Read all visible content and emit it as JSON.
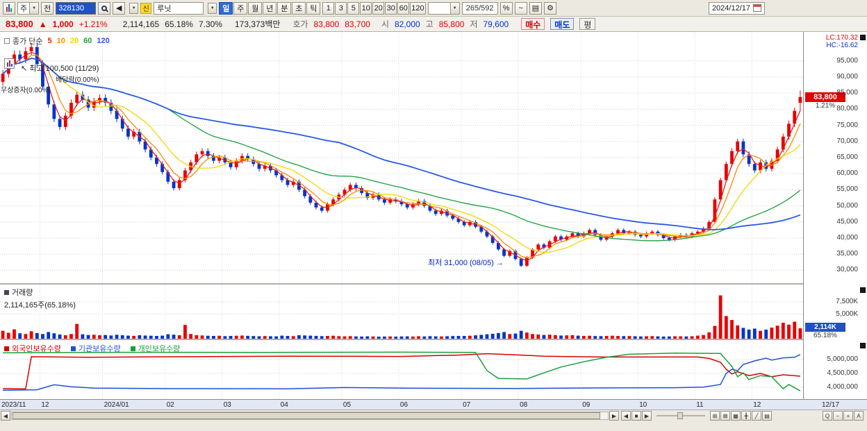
{
  "toolbar": {
    "market_combo": "주",
    "jeon_button": "전",
    "code_input": "328130",
    "prev_button": "◀",
    "new_badge": "신",
    "stock_name": "루닛",
    "period_buttons": [
      {
        "label": "일",
        "active": true
      },
      {
        "label": "주",
        "active": false
      },
      {
        "label": "월",
        "active": false
      },
      {
        "label": "년",
        "active": false
      },
      {
        "label": "분",
        "active": false
      },
      {
        "label": "초",
        "active": false
      },
      {
        "label": "틱",
        "active": false
      }
    ],
    "interval_buttons": [
      "1",
      "3",
      "5",
      "10",
      "20",
      "30",
      "60",
      "120"
    ],
    "bar_position": "265/592",
    "icons": {
      "percent": "%",
      "wave": "~",
      "save": "▤",
      "gear": "⚙"
    },
    "date": "2024/12/17"
  },
  "quote": {
    "price": "83,800",
    "arrow": "▲",
    "change": "1,000",
    "change_pct": "+1.21%",
    "volume": "2,114,165",
    "volume_ratio": "65.18%",
    "turnover": "7.30%",
    "value": "173,373백만",
    "hoga_label": "호가",
    "ask": "83,800",
    "bid": "83,700",
    "open_label": "시",
    "open": "82,000",
    "high_label": "고",
    "high": "85,800",
    "low_label": "저",
    "low": "79,600",
    "buy": "매수",
    "sell": "매도",
    "avg": "평"
  },
  "main_chart": {
    "legend_title": "종가 단순",
    "annotations": {
      "high": "최고 100,500 (11/29)",
      "high_arrow": "↖",
      "ex_dividend": "배당락(0.00%)",
      "bonus": "무상증자(0.00%)",
      "low": "최저 31,000 (08/05)",
      "low_arrow": "→"
    },
    "right_axis": {
      "lc": "LC:170.32",
      "hc": "HC:-16.62",
      "ticks": [
        95000,
        90000,
        85000,
        80000,
        75000,
        70000,
        65000,
        60000,
        55000,
        50000,
        45000,
        40000,
        35000,
        30000
      ],
      "price_box": "83,800",
      "price_box_pct": "1.21%",
      "price_box_value": 83800
    }
  },
  "volume_pane": {
    "title": "거래량",
    "subtitle": "2,114,165주(65.18%)",
    "ticks": [
      {
        "label": "7,500K",
        "v": 7500
      },
      {
        "label": "5,000K",
        "v": 5000
      }
    ],
    "box": "2,114K",
    "box_pct": "65.18%",
    "box_value": 2114
  },
  "holdings_pane": {
    "legend": [
      {
        "label": "외국인보유수량",
        "color": "#d40000"
      },
      {
        "label": "기관보유수량",
        "color": "#2050d8"
      },
      {
        "label": "개인보유수량",
        "color": "#18a038"
      }
    ],
    "ticks": [
      {
        "label": "5,000,000",
        "v": 5000000
      },
      {
        "label": "4,500,000",
        "v": 4500000
      },
      {
        "label": "4,000,000",
        "v": 4000000
      }
    ]
  },
  "x_axis": {
    "labels": [
      {
        "text": "2023/11",
        "i": 0
      },
      {
        "text": "12",
        "i": 7
      },
      {
        "text": "2024/01",
        "i": 18
      },
      {
        "text": "02",
        "i": 29
      },
      {
        "text": "03",
        "i": 39
      },
      {
        "text": "04",
        "i": 49
      },
      {
        "text": "05",
        "i": 60
      },
      {
        "text": "06",
        "i": 70
      },
      {
        "text": "07",
        "i": 81
      },
      {
        "text": "08",
        "i": 91
      },
      {
        "text": "09",
        "i": 102
      },
      {
        "text": "10",
        "i": 112
      },
      {
        "text": "11",
        "i": 122
      },
      {
        "text": "12",
        "i": 132
      }
    ],
    "end_label": "12/17"
  },
  "bottom_bar": {
    "scroll_left": "◀",
    "scroll_right": "▶",
    "playback": [
      "◀",
      "■",
      "▶"
    ],
    "tools": [
      "⊞",
      "⊠",
      "▦",
      "╋",
      "╱",
      "▤"
    ],
    "tool_names": [
      "zoom-area-icon",
      "select-box-icon",
      "grid-icon",
      "crosshair-icon",
      "trendline-icon",
      "panel-layout-icon"
    ],
    "zoom": [
      "Q",
      "−",
      "+",
      "A"
    ],
    "zoom_names": [
      "magnifier-icon",
      "zoom-out-button",
      "zoom-in-button",
      "auto-scale-button"
    ]
  },
  "chart_data": {
    "type": "candlestick",
    "price_range": [
      26000,
      104000
    ],
    "volume_range_k": [
      0,
      11000
    ],
    "holdings_range": [
      3575000,
      5700000
    ],
    "up_color": "#e80000",
    "down_color": "#0033cc",
    "first_open": 88500,
    "last_candle": {
      "open": 82000,
      "high": 85800,
      "low": 79600,
      "close": 83800
    },
    "ma": [
      {
        "label": "5",
        "color": "#e02020",
        "window": 3
      },
      {
        "label": "10",
        "color": "#ff8a00",
        "window": 5
      },
      {
        "label": "20",
        "color": "#f0d800",
        "window": 10
      },
      {
        "label": "60",
        "color": "#18a038",
        "window": 30
      },
      {
        "label": "120",
        "color": "#2858e8",
        "window": 60
      }
    ],
    "closes": [
      91000,
      94000,
      97000,
      95500,
      98000,
      99300,
      94000,
      87000,
      81500,
      77000,
      74500,
      78000,
      82000,
      84500,
      83000,
      80500,
      82500,
      83500,
      82000,
      79500,
      77000,
      74000,
      71500,
      73000,
      70000,
      67500,
      65000,
      63000,
      60500,
      57500,
      55500,
      58000,
      61000,
      63500,
      66000,
      67000,
      65500,
      64000,
      65000,
      63500,
      62000,
      64000,
      65500,
      64500,
      63000,
      61500,
      62500,
      61000,
      59500,
      58000,
      56500,
      57500,
      55000,
      53000,
      51000,
      49500,
      48500,
      50500,
      52000,
      53500,
      55000,
      56500,
      55500,
      54000,
      52500,
      53500,
      52000,
      51000,
      52000,
      51500,
      50500,
      49500,
      50500,
      51500,
      50000,
      48500,
      47500,
      48500,
      47000,
      46000,
      45000,
      44000,
      45000,
      43500,
      42000,
      40500,
      38500,
      36500,
      34500,
      36000,
      33500,
      31400,
      34000,
      36500,
      38000,
      37000,
      39000,
      40500,
      39500,
      40500,
      41500,
      40500,
      41500,
      42500,
      41000,
      39500,
      40500,
      41500,
      42500,
      41500,
      42000,
      41000,
      40500,
      41500,
      42000,
      41000,
      40000,
      39500,
      40500,
      41000,
      40500,
      41500,
      42000,
      43000,
      45000,
      52000,
      58000,
      63000,
      67000,
      70000,
      66000,
      63000,
      61000,
      63500,
      61500,
      64000,
      67500,
      71500,
      75500,
      79500,
      83800
    ],
    "volumes_k": [
      1600,
      1200,
      1900,
      1100,
      950,
      1500,
      1150,
      950,
      1350,
      1100,
      850,
      700,
      950,
      3000,
      900,
      750,
      800,
      700,
      750,
      650,
      800,
      700,
      620,
      580,
      700,
      640,
      600,
      560,
      620,
      900,
      820,
      700,
      2800,
      950,
      720,
      660,
      600,
      560,
      600,
      520,
      560,
      600,
      640,
      580,
      540,
      500,
      540,
      500,
      480,
      620,
      560,
      520,
      700,
      660,
      620,
      580,
      520,
      560,
      600,
      520,
      480,
      520,
      460,
      440,
      480,
      460,
      420,
      440,
      460,
      430,
      460,
      480,
      440,
      500,
      460,
      520,
      480,
      460,
      500,
      540,
      560,
      560,
      600,
      680,
      780,
      900,
      1000,
      1150,
      1350,
      950,
      1050,
      1600,
      1250,
      950,
      850,
      750,
      820,
      720,
      640,
      680,
      720,
      620,
      560,
      600,
      540,
      520,
      560,
      600,
      560,
      520,
      540,
      500,
      460,
      500,
      520,
      480,
      440,
      460,
      500,
      480,
      460,
      500,
      620,
      750,
      1300,
      2600,
      8800,
      4600,
      3800,
      2700,
      2200,
      1850,
      2050,
      1600,
      1850,
      2250,
      2650,
      3250,
      2850,
      3450,
      2114
    ],
    "holdings": {
      "foreign": [
        [
          0,
          3950000
        ],
        [
          4,
          3940000
        ],
        [
          5,
          5100000
        ],
        [
          15,
          5080000
        ],
        [
          30,
          5100000
        ],
        [
          50,
          5120000
        ],
        [
          70,
          5110000
        ],
        [
          80,
          5160000
        ],
        [
          85,
          5210000
        ],
        [
          90,
          5170000
        ],
        [
          95,
          5120000
        ],
        [
          105,
          5090000
        ],
        [
          115,
          5090000
        ],
        [
          122,
          5090000
        ],
        [
          124,
          5040000
        ],
        [
          126,
          4900000
        ],
        [
          127,
          4650000
        ],
        [
          128,
          4480000
        ],
        [
          129,
          4560000
        ],
        [
          131,
          4420000
        ],
        [
          133,
          4500000
        ],
        [
          135,
          4380000
        ],
        [
          137,
          4450000
        ],
        [
          140,
          4400000
        ]
      ],
      "institution": [
        [
          0,
          3890000
        ],
        [
          6,
          3910000
        ],
        [
          9,
          4090000
        ],
        [
          12,
          4020000
        ],
        [
          16,
          3970000
        ],
        [
          30,
          3950000
        ],
        [
          50,
          3945000
        ],
        [
          60,
          3990000
        ],
        [
          72,
          3965000
        ],
        [
          90,
          3955000
        ],
        [
          104,
          3975000
        ],
        [
          118,
          3985000
        ],
        [
          123,
          4005000
        ],
        [
          126,
          4100000
        ],
        [
          127,
          4500000
        ],
        [
          128,
          4650000
        ],
        [
          129,
          4600000
        ],
        [
          130,
          4820000
        ],
        [
          132,
          4950000
        ],
        [
          134,
          5050000
        ],
        [
          135,
          4980000
        ],
        [
          137,
          5060000
        ],
        [
          139,
          5080000
        ],
        [
          140,
          5180000
        ]
      ],
      "individual": [
        [
          0,
          5240000
        ],
        [
          20,
          5260000
        ],
        [
          45,
          5255000
        ],
        [
          70,
          5265000
        ],
        [
          83,
          5255000
        ],
        [
          85,
          4600000
        ],
        [
          87,
          4320000
        ],
        [
          92,
          4300000
        ],
        [
          95,
          4520000
        ],
        [
          98,
          4730000
        ],
        [
          102,
          4920000
        ],
        [
          106,
          5080000
        ],
        [
          110,
          5190000
        ],
        [
          118,
          5230000
        ],
        [
          126,
          5220000
        ],
        [
          128,
          4750000
        ],
        [
          129,
          4380000
        ],
        [
          130,
          4520000
        ],
        [
          131,
          4280000
        ],
        [
          133,
          4420000
        ],
        [
          135,
          4380000
        ],
        [
          137,
          3950000
        ],
        [
          138,
          4100000
        ],
        [
          140,
          3870000
        ]
      ]
    }
  }
}
